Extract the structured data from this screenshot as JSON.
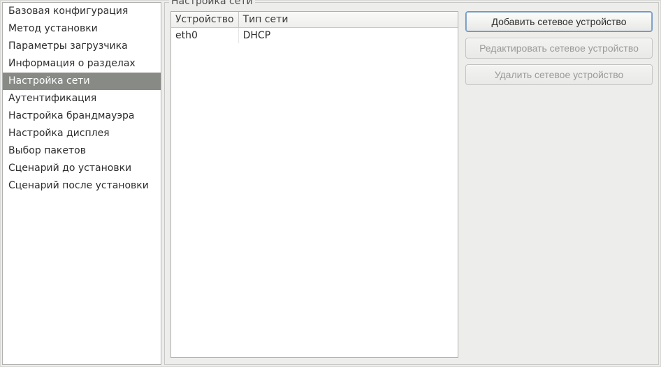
{
  "sidebar": {
    "items": [
      {
        "label": "Базовая конфигурация",
        "selected": false
      },
      {
        "label": "Метод установки",
        "selected": false
      },
      {
        "label": "Параметры загрузчика",
        "selected": false
      },
      {
        "label": "Информация о разделах",
        "selected": false
      },
      {
        "label": "Настройка сети",
        "selected": true
      },
      {
        "label": "Аутентификация",
        "selected": false
      },
      {
        "label": "Настройка брандмауэра",
        "selected": false
      },
      {
        "label": "Настройка дисплея",
        "selected": false
      },
      {
        "label": "Выбор пакетов",
        "selected": false
      },
      {
        "label": "Сценарий до установки",
        "selected": false
      },
      {
        "label": "Сценарий после установки",
        "selected": false
      }
    ]
  },
  "panel": {
    "title": "Настройка сети",
    "table": {
      "columns": {
        "device": "Устройство",
        "nettype": "Тип сети"
      },
      "rows": [
        {
          "device": "eth0",
          "nettype": "DHCP"
        }
      ]
    },
    "buttons": {
      "add": {
        "label": "Добавить сетевое устройство",
        "enabled": true,
        "focused": true
      },
      "edit": {
        "label": "Редактировать сетевое устройство",
        "enabled": false
      },
      "delete": {
        "label": "Удалить сетевое устройство",
        "enabled": false
      }
    }
  }
}
